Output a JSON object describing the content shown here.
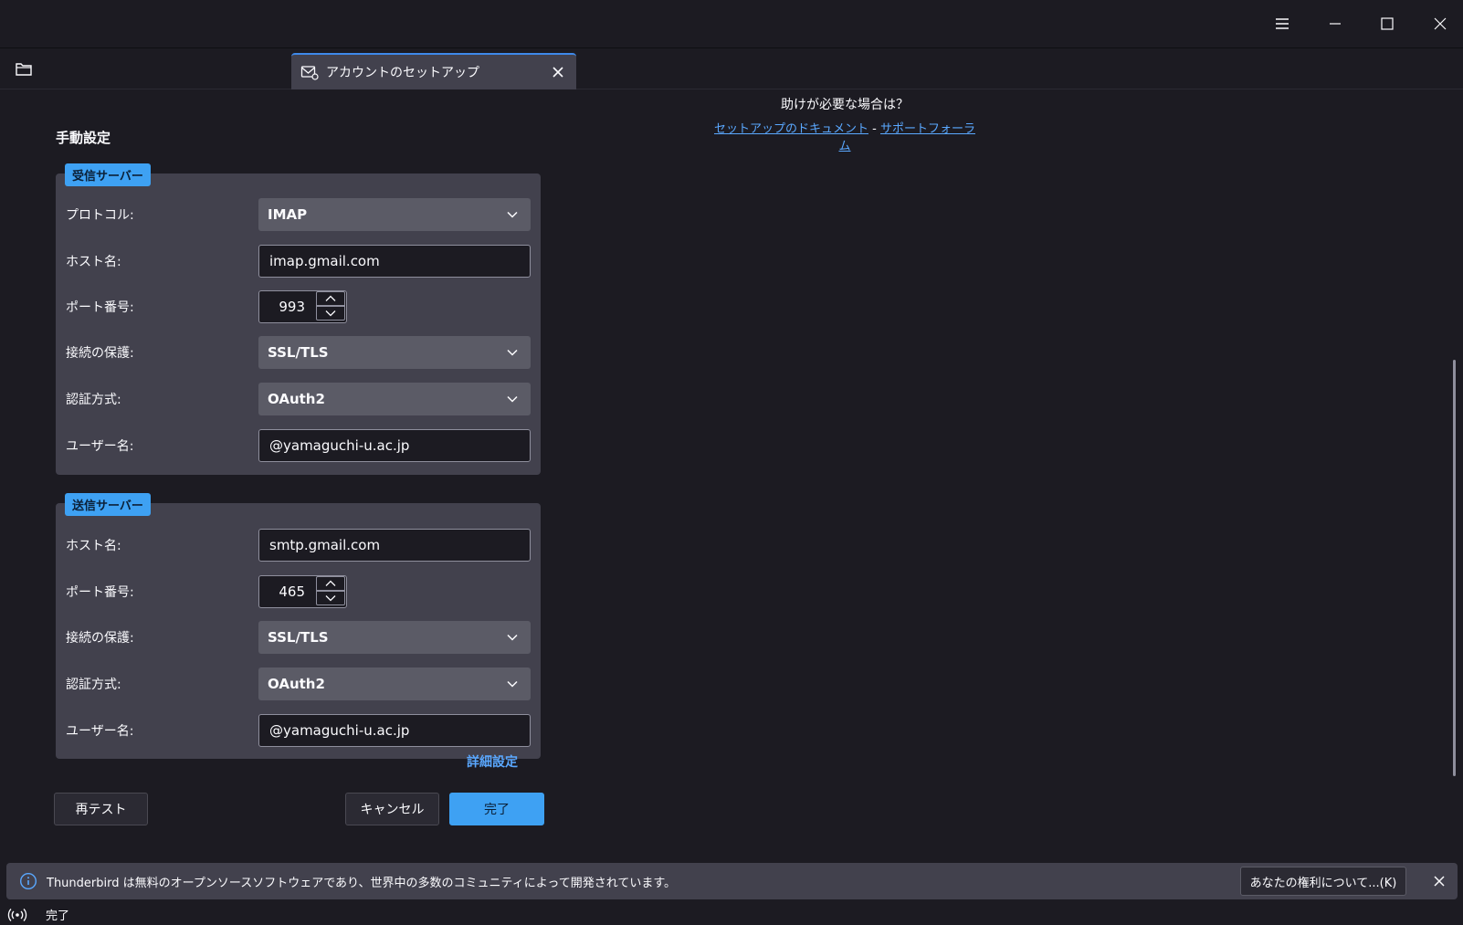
{
  "window": {
    "menu_icon": "hamburger-menu-icon",
    "minimize_icon": "minimize-icon",
    "maximize_icon": "maximize-icon",
    "close_icon": "close-icon"
  },
  "tabs": [
    {
      "label": "アカウントのセットアップ",
      "icon": "mail-setup-icon",
      "active": true
    }
  ],
  "help": {
    "title": "助けが必要な場合は？",
    "link_docs": "セットアップのドキュメント",
    "separator": "-",
    "link_forum": "サポートフォーラム"
  },
  "manual": {
    "title": "手動設定",
    "incoming": {
      "legend": "受信サーバー",
      "protocol_label": "プロトコル:",
      "protocol_value": "IMAP",
      "host_label": "ホスト名:",
      "host_value": "imap.gmail.com",
      "port_label": "ポート番号:",
      "port_value": "993",
      "security_label": "接続の保護:",
      "security_value": "SSL/TLS",
      "auth_label": "認証方式:",
      "auth_value": "OAuth2",
      "user_label": "ユーザー名:",
      "user_value": "@yamaguchi-u.ac.jp"
    },
    "outgoing": {
      "legend": "送信サーバー",
      "host_label": "ホスト名:",
      "host_value": "smtp.gmail.com",
      "port_label": "ポート番号:",
      "port_value": "465",
      "security_label": "接続の保護:",
      "security_value": "SSL/TLS",
      "auth_label": "認証方式:",
      "auth_value": "OAuth2",
      "user_label": "ユーザー名:",
      "user_value": "@yamaguchi-u.ac.jp"
    },
    "advanced_link": "詳細設定"
  },
  "buttons": {
    "retest": "再テスト",
    "cancel": "キャンセル",
    "done": "完了"
  },
  "notification": {
    "text": "Thunderbird は無料のオープンソースソフトウェアであり、世界中の多数のコミュニティによって開発されています。",
    "button": "あなたの権利について...(K)"
  },
  "status": {
    "text": "完了"
  },
  "colors": {
    "accent": "#3ea1f3",
    "link": "#5aa8ff",
    "background": "#1c1b22",
    "panel": "#42414d"
  }
}
